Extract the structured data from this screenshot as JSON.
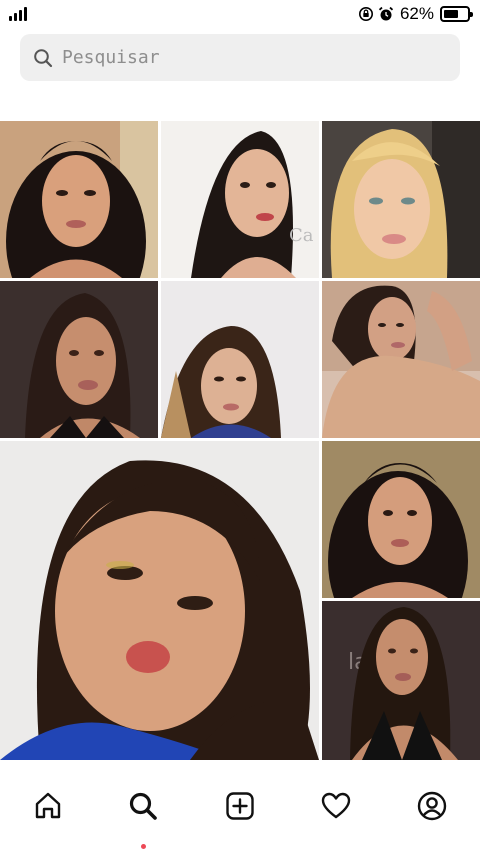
{
  "status_bar": {
    "battery_percent": "62%",
    "battery_level": 0.62,
    "icons": [
      "signal-bars-icon",
      "rotation-lock-icon",
      "alarm-clock-icon",
      "battery-icon"
    ]
  },
  "search": {
    "placeholder": "Pesquisar",
    "value": "",
    "icon": "search-icon"
  },
  "explore_grid": {
    "tiles": [
      {
        "name": "post-thumbnail-1"
      },
      {
        "name": "post-thumbnail-2"
      },
      {
        "name": "post-thumbnail-3"
      },
      {
        "name": "post-thumbnail-4"
      },
      {
        "name": "post-thumbnail-5"
      },
      {
        "name": "post-thumbnail-6"
      },
      {
        "name": "post-thumbnail-large"
      },
      {
        "name": "post-thumbnail-7"
      },
      {
        "name": "post-thumbnail-8"
      }
    ]
  },
  "bottom_nav": {
    "items": [
      {
        "name": "home",
        "icon": "home-icon",
        "active": false
      },
      {
        "name": "search",
        "icon": "search-icon",
        "active": true
      },
      {
        "name": "create",
        "icon": "plus-square-icon",
        "active": false
      },
      {
        "name": "activity",
        "icon": "heart-icon",
        "active": false
      },
      {
        "name": "profile",
        "icon": "profile-icon",
        "active": false
      }
    ],
    "active_indicator_color": "#ed4956"
  }
}
